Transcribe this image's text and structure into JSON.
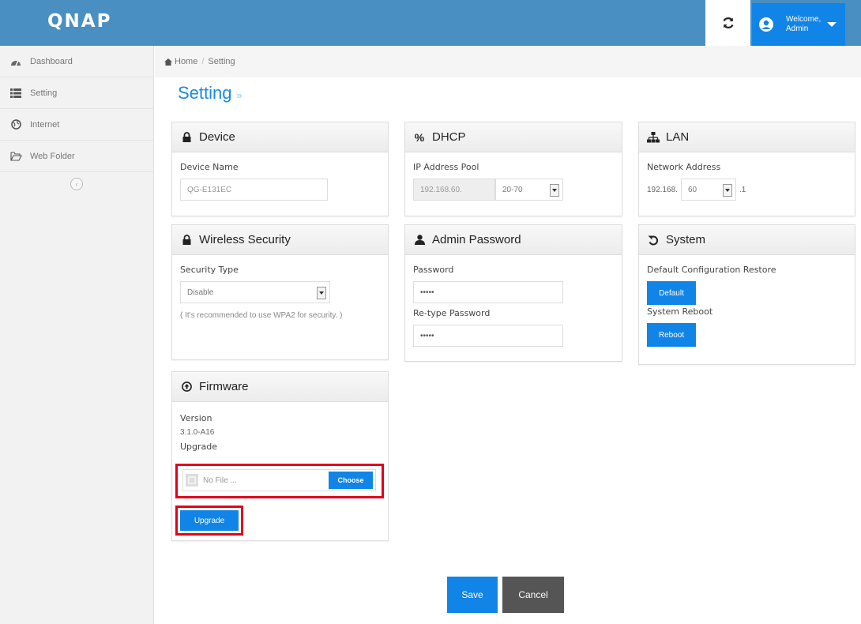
{
  "header": {
    "logo": "QNAP",
    "welcome_line1": "Welcome,",
    "welcome_line2": "Admin"
  },
  "sidebar": {
    "items": [
      {
        "label": "Dashboard",
        "icon": "dashboard-icon"
      },
      {
        "label": "Setting",
        "icon": "list-icon"
      },
      {
        "label": "Internet",
        "icon": "globe-icon"
      },
      {
        "label": "Web Folder",
        "icon": "folder-icon"
      }
    ]
  },
  "breadcrumb": {
    "home": "Home",
    "current": "Setting"
  },
  "page": {
    "title": "Setting",
    "chevron": "»"
  },
  "device": {
    "title": "Device",
    "label": "Device Name",
    "value": "QG-E131EC"
  },
  "dhcp": {
    "title": "DHCP",
    "label": "IP Address Pool",
    "prefix": "192.168.60.",
    "range": "20-70"
  },
  "lan": {
    "title": "LAN",
    "label": "Network Address",
    "prefix": "192.168.",
    "octet": "60",
    "suffix": ".1"
  },
  "wireless": {
    "title": "Wireless Security",
    "label": "Security Type",
    "value": "Disable",
    "hint": "( It's recommended to use WPA2 for security. )"
  },
  "admin": {
    "title": "Admin Password",
    "password_label": "Password",
    "password_value": "•••••",
    "retype_label": "Re-type Password",
    "retype_value": "•••••"
  },
  "system": {
    "title": "System",
    "restore_label": "Default Configuration Restore",
    "default_btn": "Default",
    "reboot_label": "System Reboot",
    "reboot_btn": "Reboot"
  },
  "firmware": {
    "title": "Firmware",
    "version_label": "Version",
    "version_value": "3.1.0-A16",
    "upgrade_label": "Upgrade",
    "file_placeholder": "No File ...",
    "choose_btn": "Choose",
    "upgrade_btn": "Upgrade"
  },
  "footer": {
    "save": "Save",
    "cancel": "Cancel"
  },
  "colors": {
    "topbar": "#4a8fc2",
    "accent": "#1184e8",
    "highlight": "#e3001b",
    "cancel": "#555555"
  }
}
